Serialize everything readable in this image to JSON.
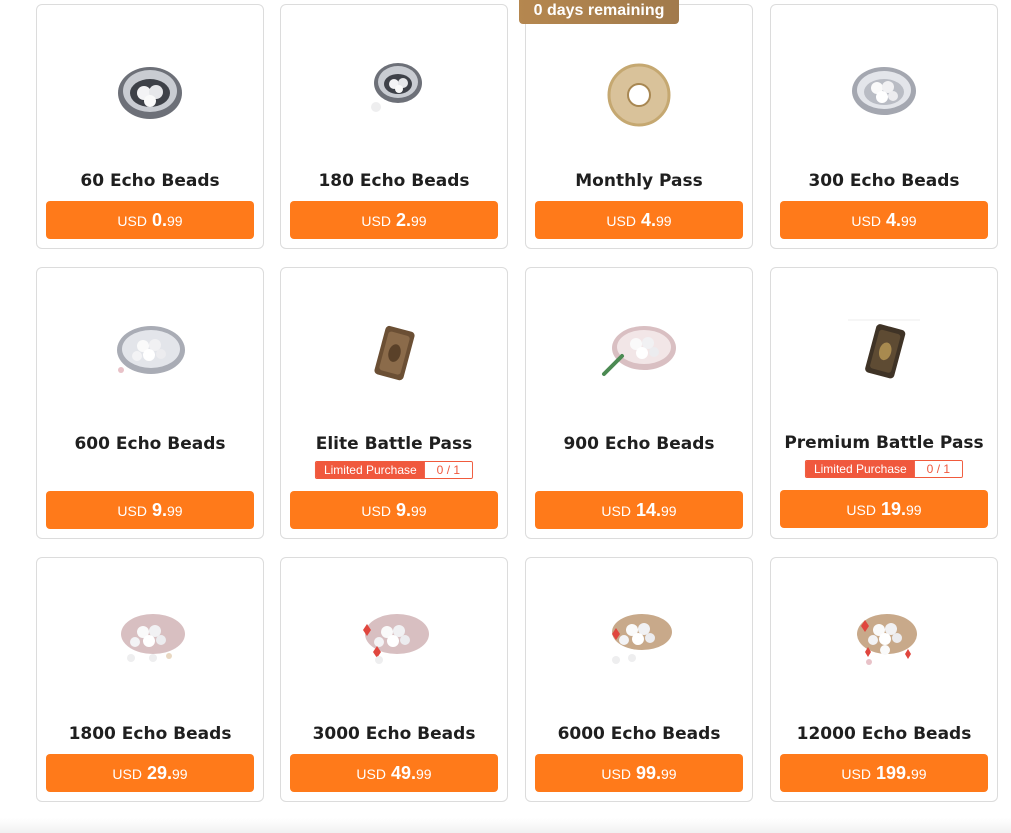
{
  "banner": {
    "days_remaining": "0 days remaining"
  },
  "products": [
    {
      "title": "60 Echo Beads",
      "currency": "USD",
      "price_int": "0.",
      "price_dec": "99",
      "icon": "shell-pearls-icon"
    },
    {
      "title": "180 Echo Beads",
      "currency": "USD",
      "price_int": "2.",
      "price_dec": "99",
      "icon": "shell-pearls-icon"
    },
    {
      "title": "Monthly Pass",
      "currency": "USD",
      "price_int": "4.",
      "price_dec": "99",
      "icon": "jade-disc-icon"
    },
    {
      "title": "300 Echo Beads",
      "currency": "USD",
      "price_int": "4.",
      "price_dec": "99",
      "icon": "shell-pearls-icon"
    },
    {
      "title": "600 Echo Beads",
      "currency": "USD",
      "price_int": "9.",
      "price_dec": "99",
      "icon": "shell-pearls-icon"
    },
    {
      "title": "Elite Battle Pass",
      "currency": "USD",
      "price_int": "9.",
      "price_dec": "99",
      "icon": "bronze-token-icon",
      "limit_label": "Limited Purchase",
      "limit_count": "0 / 1"
    },
    {
      "title": "900 Echo Beads",
      "currency": "USD",
      "price_int": "14.",
      "price_dec": "99",
      "icon": "shell-pearls-icon"
    },
    {
      "title": "Premium Battle Pass",
      "currency": "USD",
      "price_int": "19.",
      "price_dec": "99",
      "icon": "bronze-token-icon",
      "limit_label": "Limited Purchase",
      "limit_count": "0 / 1"
    },
    {
      "title": "1800 Echo Beads",
      "currency": "USD",
      "price_int": "29.",
      "price_dec": "99",
      "icon": "shell-pearls-icon"
    },
    {
      "title": "3000 Echo Beads",
      "currency": "USD",
      "price_int": "49.",
      "price_dec": "99",
      "icon": "shell-pearls-icon"
    },
    {
      "title": "6000 Echo Beads",
      "currency": "USD",
      "price_int": "99.",
      "price_dec": "99",
      "icon": "shell-pearls-icon"
    },
    {
      "title": "12000 Echo Beads",
      "currency": "USD",
      "price_int": "199.",
      "price_dec": "99",
      "icon": "shell-pearls-icon"
    }
  ],
  "colors": {
    "button": "#ff7a1a",
    "banner": "#a9804d",
    "limit_badge": "#f0583d",
    "card_border": "#dcdcdc"
  }
}
